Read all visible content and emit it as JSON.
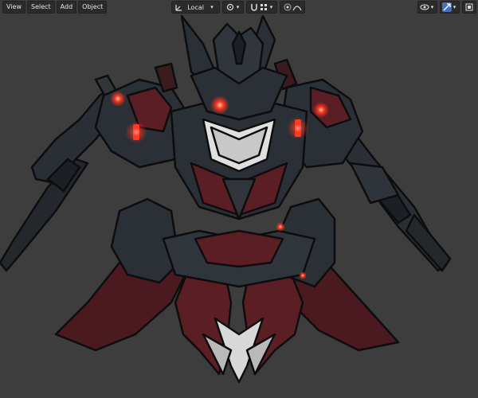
{
  "header": {
    "menus": [
      "View",
      "Select",
      "Add",
      "Object"
    ],
    "transform_orientation": "Local"
  },
  "icons": {
    "orientation": "axis-icon",
    "snap": "snap-magnet-icon",
    "pivot": "pivot-point-icon",
    "proportional": "proportional-edit-icon",
    "falloff": "falloff-curve-icon",
    "gizmo": "viewport-gizmo-icon",
    "overlays": "overlays-icon",
    "xray": "xray-icon"
  },
  "colors": {
    "viewport_bg": "#3d3d3d",
    "header_btn": "#2b2b2b",
    "accent_blue": "#4772b3",
    "glow_red": "#ff2a1a",
    "armor_dark": "#2a3036",
    "armor_red": "#5a1e24"
  }
}
